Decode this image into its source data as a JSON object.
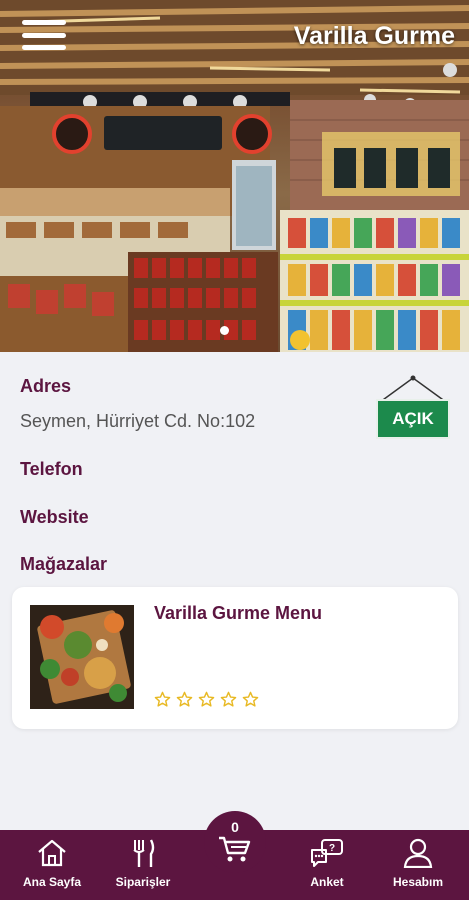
{
  "header": {
    "title": "Varilla Gurme",
    "menu_icon": "hamburger-icon"
  },
  "carousel": {
    "slide_count": 1,
    "active_index": 0
  },
  "info": {
    "address_label": "Adres",
    "address_value": "Seymen, Hürriyet Cd. No:102",
    "phone_label": "Telefon",
    "website_label": "Website",
    "stores_label": "Mağazalar",
    "status_sign": "AÇIK"
  },
  "menu_card": {
    "title": "Varilla Gurme Menu",
    "rating": 0,
    "rating_max": 5
  },
  "bottom_nav": {
    "home": "Ana Sayfa",
    "orders": "Siparişler",
    "cart_count": "0",
    "survey": "Anket",
    "account": "Hesabım"
  },
  "colors": {
    "brand": "#5c1540",
    "open_green": "#1c8a4c",
    "star": "#e8b923",
    "background": "#f0f1f5"
  }
}
